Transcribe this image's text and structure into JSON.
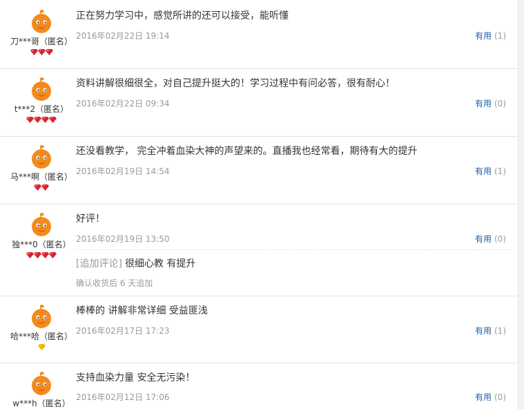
{
  "reviews": [
    {
      "user": "刀***哥（匿名）",
      "content": "正在努力学习中，感觉所讲的还可以接受，能听懂",
      "date": "2016年02月22日 19:14",
      "useful_label": "有用",
      "useful_count": "(1)",
      "gem_count": 3,
      "gem_type": "red"
    },
    {
      "user": "t***2（匿名）",
      "content": "资料讲解很细很全，对自己提升挺大的！学习过程中有问必答，很有耐心！",
      "date": "2016年02月22日 09:34",
      "useful_label": "有用",
      "useful_count": "(0)",
      "gem_count": 4,
      "gem_type": "red"
    },
    {
      "user": "马***啊（匿名）",
      "content": "还没看教学， 完全冲着血染大神的声望来的。直播我也经常看，期待有大的提升",
      "date": "2016年02月19日 14:54",
      "useful_label": "有用",
      "useful_count": "(1)",
      "gem_count": 2,
      "gem_type": "red"
    },
    {
      "user": "独***0（匿名）",
      "content": "好评！",
      "date": "2016年02月19日 13:50",
      "useful_label": "有用",
      "useful_count": "(0)",
      "gem_count": 4,
      "gem_type": "red",
      "append_tag": "[追加评论]",
      "append_text": "很细心教 有提升",
      "append_meta": "确认收货后 6 天追加"
    },
    {
      "user": "哈***哈（匿名）",
      "content": "棒棒的 讲解非常详细 受益匪浅",
      "date": "2016年02月17日 17:23",
      "useful_label": "有用",
      "useful_count": "(1)",
      "gem_count": 1,
      "gem_type": "yellow"
    },
    {
      "user": "w***h（匿名）",
      "content": "支持血染力量 安全无污染！",
      "date": "2016年02月12日 17:06",
      "useful_label": "有用",
      "useful_count": "(0)",
      "gem_count": 0,
      "gem_type": "red"
    }
  ],
  "colors": {
    "link": "#1a5fa8",
    "muted": "#999999",
    "text": "#333333",
    "gem_red": "#d9262f",
    "gem_yellow": "#f0b400",
    "avatar": "#f38a1c"
  }
}
